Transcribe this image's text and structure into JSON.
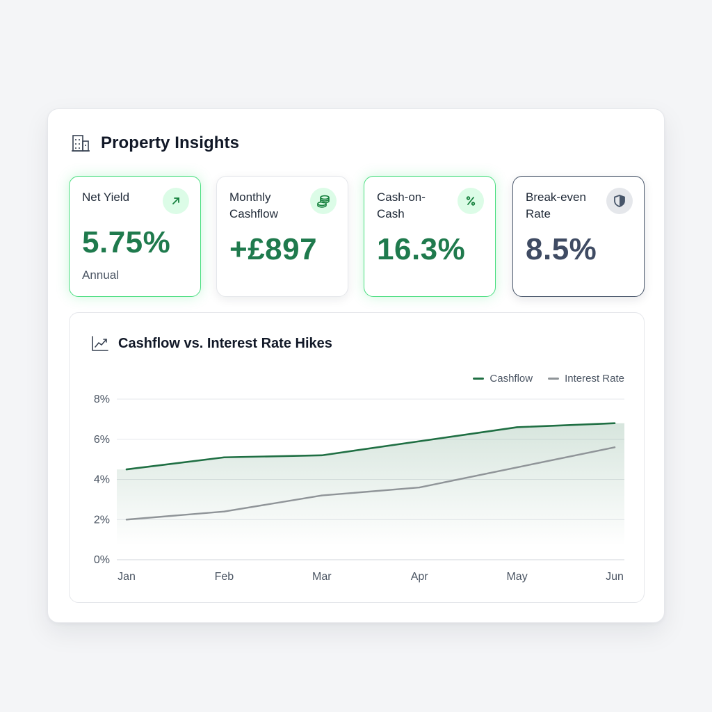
{
  "panel": {
    "title": "Property Insights",
    "icon": "building-icon"
  },
  "cards": [
    {
      "label": "Net Yield",
      "value": "5.75%",
      "sub": "Annual",
      "icon": "arrow-up-right-icon",
      "style": "green"
    },
    {
      "label": "Monthly Cashflow",
      "value": "+£897",
      "icon": "coins-icon",
      "style": "neutral"
    },
    {
      "label": "Cash-on-Cash",
      "value": "16.3%",
      "icon": "percent-icon",
      "style": "green"
    },
    {
      "label": "Break-even Rate",
      "value": "8.5%",
      "icon": "shield-icon",
      "style": "slate"
    }
  ],
  "chart": {
    "title": "Cashflow vs. Interest Rate Hikes",
    "icon": "line-chart-icon"
  },
  "colors": {
    "cashflow": "#1f6f43",
    "interest": "#8f9498",
    "accent_green": "#4ade80",
    "slate": "#475569"
  },
  "chart_data": {
    "type": "line",
    "categories": [
      "Jan",
      "Feb",
      "Mar",
      "Apr",
      "May",
      "Jun"
    ],
    "series": [
      {
        "name": "Cashflow",
        "values": [
          4.5,
          5.1,
          5.2,
          5.9,
          6.6,
          6.8
        ],
        "color": "#1f6f43",
        "fill": true
      },
      {
        "name": "Interest Rate",
        "values": [
          2.0,
          2.4,
          3.2,
          3.6,
          4.6,
          5.6
        ],
        "color": "#8f9498"
      }
    ],
    "yticks": [
      "0%",
      "2%",
      "4%",
      "6%",
      "8%"
    ],
    "ylim": [
      0,
      8
    ],
    "grid": true,
    "legend": "top-right"
  }
}
